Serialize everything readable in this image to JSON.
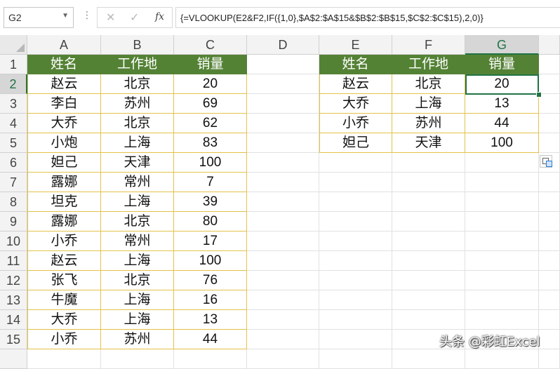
{
  "formula_bar": {
    "name_box": "G2",
    "cancel_icon": "✕",
    "enter_icon": "✓",
    "fx_label": "fx",
    "formula": "{=VLOOKUP(E2&F2,IF({1,0},$A$2:$A$15&$B$2:$B$15,$C$2:$C$15),2,0)}"
  },
  "columns": [
    "A",
    "B",
    "C",
    "D",
    "E",
    "F",
    "G"
  ],
  "selected_cell": "G2",
  "rows": [
    "1",
    "2",
    "3",
    "4",
    "5",
    "6",
    "7",
    "8",
    "9",
    "10",
    "11",
    "12",
    "13",
    "14",
    "15"
  ],
  "source_table": {
    "headers": [
      "姓名",
      "工作地",
      "销量"
    ],
    "rows": [
      [
        "赵云",
        "北京",
        "20"
      ],
      [
        "李白",
        "苏州",
        "69"
      ],
      [
        "大乔",
        "北京",
        "62"
      ],
      [
        "小炮",
        "上海",
        "83"
      ],
      [
        "妲己",
        "天津",
        "100"
      ],
      [
        "露娜",
        "常州",
        "7"
      ],
      [
        "坦克",
        "上海",
        "39"
      ],
      [
        "露娜",
        "北京",
        "80"
      ],
      [
        "小乔",
        "常州",
        "17"
      ],
      [
        "赵云",
        "上海",
        "100"
      ],
      [
        "张飞",
        "北京",
        "76"
      ],
      [
        "牛魔",
        "上海",
        "16"
      ],
      [
        "大乔",
        "上海",
        "13"
      ],
      [
        "小乔",
        "苏州",
        "44"
      ]
    ]
  },
  "lookup_table": {
    "headers": [
      "姓名",
      "工作地",
      "销量"
    ],
    "rows": [
      [
        "赵云",
        "北京",
        "20"
      ],
      [
        "大乔",
        "上海",
        "13"
      ],
      [
        "小乔",
        "苏州",
        "44"
      ],
      [
        "妲己",
        "天津",
        "100"
      ]
    ]
  },
  "watermark": "头条 @彩虹Excel",
  "colors": {
    "header_fill": "#548235",
    "header_text": "#ffffff",
    "table_border": "#e3c24a",
    "selection": "#217346"
  }
}
